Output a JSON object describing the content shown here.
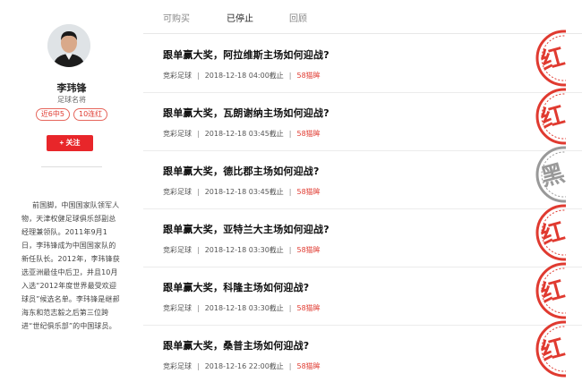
{
  "sidebar": {
    "name": "李玮锋",
    "title": "足球名将",
    "badges": [
      "近6中5",
      "10连红"
    ],
    "follow_label": "+ 关注",
    "bio": "前国脚，中国国家队领军人物，天津权健足球俱乐部副总经理兼领队。2011年9月1日，李玮锋成为中国国家队的新任队长。2012年，李玮锋获选亚洲最佳中后卫，并且10月入选“2012年度世界最受欢迎球员”候选名单。李玮锋是继郝海东和范志毅之后第三位跨进“世纪俱乐部”的中国球员。"
  },
  "tabs": [
    {
      "label": "可购买",
      "active": false
    },
    {
      "label": "已停止",
      "active": true
    },
    {
      "label": "回顾",
      "active": false
    }
  ],
  "items": [
    {
      "title": "跟单赢大奖，阿拉维斯主场如何迎战?",
      "category": "竞彩足球",
      "deadline": "2018-12-18 04:00截止",
      "price": "58猫眸",
      "stamp": "红"
    },
    {
      "title": "跟单赢大奖，瓦朗谢纳主场如何迎战?",
      "category": "竞彩足球",
      "deadline": "2018-12-18 03:45截止",
      "price": "58猫眸",
      "stamp": "红"
    },
    {
      "title": "跟单赢大奖，德比郡主场如何迎战?",
      "category": "竞彩足球",
      "deadline": "2018-12-18 03:45截止",
      "price": "58猫眸",
      "stamp": "黑"
    },
    {
      "title": "跟单赢大奖，亚特兰大主场如何迎战?",
      "category": "竞彩足球",
      "deadline": "2018-12-18 03:30截止",
      "price": "58猫眸",
      "stamp": "红"
    },
    {
      "title": "跟单赢大奖，科隆主场如何迎战?",
      "category": "竞彩足球",
      "deadline": "2018-12-18 03:30截止",
      "price": "58猫眸",
      "stamp": "红"
    },
    {
      "title": "跟单赢大奖，桑普主场如何迎战?",
      "category": "竞彩足球",
      "deadline": "2018-12-16 22:00截止",
      "price": "58猫眸",
      "stamp": "红"
    }
  ],
  "colors": {
    "accent": "#e8262a",
    "stamp_red": "#e03a30",
    "stamp_black": "#999999"
  }
}
